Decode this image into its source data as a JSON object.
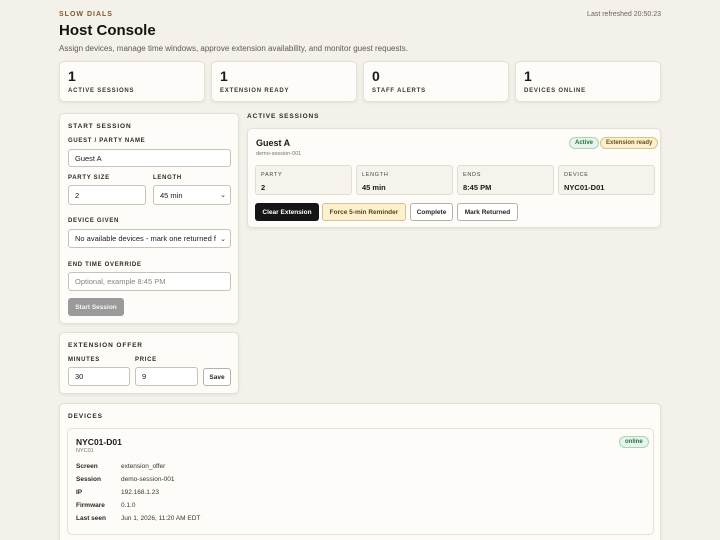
{
  "header": {
    "brand": "SLOW DIALS",
    "title": "Host Console",
    "subtitle": "Assign devices, manage time windows, approve extension availability, and monitor guest requests.",
    "last_refreshed": "Last refreshed 20:50:23"
  },
  "stats": [
    {
      "value": "1",
      "label": "ACTIVE SESSIONS"
    },
    {
      "value": "1",
      "label": "EXTENSION READY"
    },
    {
      "value": "0",
      "label": "STAFF ALERTS"
    },
    {
      "value": "1",
      "label": "DEVICES ONLINE"
    }
  ],
  "start_session": {
    "heading": "START SESSION",
    "guest_label": "GUEST / PARTY NAME",
    "guest_value": "Guest A",
    "party_size_label": "PARTY SIZE",
    "party_size_value": "2",
    "length_label": "LENGTH",
    "length_value": "45 min",
    "device_label": "DEVICE GIVEN",
    "device_value": "No available devices - mark one returned f",
    "end_time_label": "END TIME OVERRIDE",
    "end_time_placeholder": "Optional, example 8:45 PM",
    "submit_label": "Start Session"
  },
  "extension_offer": {
    "heading": "EXTENSION OFFER",
    "minutes_label": "MINUTES",
    "minutes_value": "30",
    "price_label": "PRICE",
    "price_value": "9",
    "save_label": "Save"
  },
  "active_sessions": {
    "heading": "ACTIVE SESSIONS",
    "session": {
      "guest": "Guest A",
      "id": "demo-session-001",
      "badge_status": "Active",
      "badge_extension": "Extension ready",
      "metrics": [
        {
          "label": "PARTY",
          "value": "2"
        },
        {
          "label": "LENGTH",
          "value": "45 min"
        },
        {
          "label": "ENDS",
          "value": "8:45 PM"
        },
        {
          "label": "DEVICE",
          "value": "NYC01-D01"
        }
      ],
      "actions": {
        "clear_extension": "Clear Extension",
        "force_reminder": "Force 5-min Reminder",
        "complete": "Complete",
        "mark_returned": "Mark Returned"
      }
    }
  },
  "devices": {
    "heading": "DEVICES",
    "device": {
      "name": "NYC01-D01",
      "location": "NYC01",
      "status": "online",
      "fields": [
        {
          "key": "Screen",
          "value": "extension_offer"
        },
        {
          "key": "Session",
          "value": "demo-session-001"
        },
        {
          "key": "IP",
          "value": "192.168.1.23"
        },
        {
          "key": "Firmware",
          "value": "0.1.0"
        },
        {
          "key": "Last seen",
          "value": "Jun 1, 2026, 11:20 AM EDT"
        }
      ]
    }
  },
  "colors": {
    "background": "#f4f1ea",
    "primary_button": "#151515",
    "accent_amber": "#fbf0cf",
    "online_green": "#2c6e44"
  }
}
